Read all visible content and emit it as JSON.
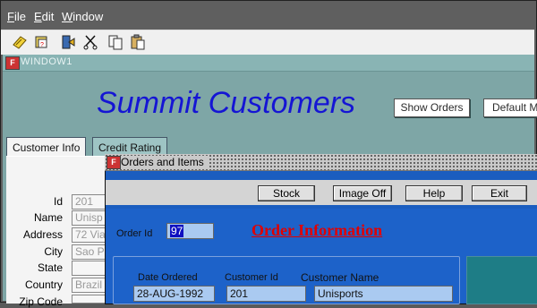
{
  "menubar": {
    "items": [
      {
        "label": "File",
        "mnemonic": "F",
        "rest": "ile"
      },
      {
        "label": "Edit",
        "mnemonic": "E",
        "rest": "dit"
      },
      {
        "label": "Window",
        "mnemonic": "W",
        "rest": "indow"
      }
    ]
  },
  "toolbar": {
    "icons": [
      "save-icon",
      "print-icon",
      "exit-icon",
      "cut-icon",
      "copy-icon",
      "paste-icon"
    ]
  },
  "window1": {
    "title": "WINDOW1",
    "heading": "Summit Customers",
    "show_orders_label": "Show Orders",
    "default_label": "Default M",
    "tabs": [
      "Customer Info",
      "Credit Rating"
    ],
    "fields": [
      {
        "label": "Id",
        "value": "201"
      },
      {
        "label": "Name",
        "value": "Unisp"
      },
      {
        "label": "Address",
        "value": "72 Via"
      },
      {
        "label": "City",
        "value": "Sao P"
      },
      {
        "label": "State",
        "value": ""
      },
      {
        "label": "Country",
        "value": "Brazil"
      },
      {
        "label": "Zip Code",
        "value": ""
      }
    ]
  },
  "orders_window": {
    "title": "Orders and Items",
    "buttons": {
      "stock": "Stock",
      "image_off": "Image Off",
      "help": "Help",
      "exit": "Exit"
    },
    "order_id_label": "Order Id",
    "order_id_value": "97",
    "section_title": "Order Information",
    "date_ordered_label": "Date Ordered",
    "date_ordered_value": "28-AUG-1992",
    "customer_id_label": "Customer Id",
    "customer_id_value": "201",
    "customer_name_label": "Customer Name",
    "customer_name_value": "Unisports"
  },
  "colors": {
    "heading": "#1515d4",
    "section_title": "#e00000",
    "window_bg": "#7ea6a6",
    "orders_bg": "#1d62c9"
  }
}
